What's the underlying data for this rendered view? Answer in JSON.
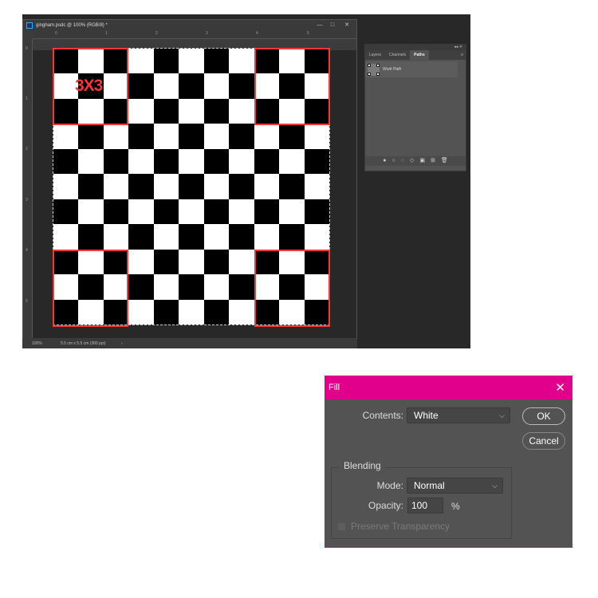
{
  "document": {
    "title": "gingham.psdc @ 100% (RGB/8) *",
    "zoom": "100%",
    "doc_info": "5.5 cm x 5.5 cm (300 ppi)",
    "status_arrow": "›",
    "h_ruler": [
      "0",
      "1",
      "2",
      "3",
      "4",
      "5"
    ],
    "v_ruler": [
      "0",
      "1",
      "2",
      "3",
      "4",
      "5"
    ],
    "annotation": "3X3",
    "grid_size": 11
  },
  "window_controls": {
    "minimize": "—",
    "maximize": "□",
    "close": "✕"
  },
  "panel": {
    "collapse": "◂◂",
    "close": "✕",
    "menu": "≡",
    "tabs": [
      {
        "label": "Layers"
      },
      {
        "label": "Channels"
      },
      {
        "label": "Paths",
        "active": true
      }
    ],
    "paths": [
      {
        "name": "Work Path"
      }
    ],
    "footer_icons": [
      "fill-path-icon",
      "stroke-path-icon",
      "load-selection-icon",
      "make-work-path-icon",
      "add-mask-icon",
      "new-path-icon",
      "trash-icon"
    ]
  },
  "dialog": {
    "title": "Fill",
    "close": "✕",
    "contents_label": "Contents:",
    "contents_value": "White",
    "ok": "OK",
    "cancel": "Cancel",
    "blending_title": "Blending",
    "mode_label": "Mode:",
    "mode_value": "Normal",
    "opacity_label": "Opacity:",
    "opacity_value": "100",
    "opacity_unit": "%",
    "preserve_label": "Preserve Transparency",
    "preserve_checked": false,
    "accent": "#e0008c"
  },
  "colors": {
    "selection_red": "#f23838"
  }
}
